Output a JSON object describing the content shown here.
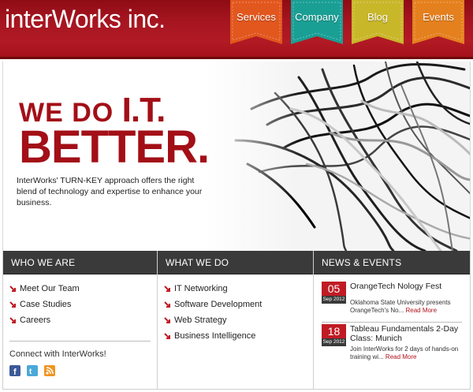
{
  "header": {
    "logo_text": "interWorks inc.",
    "nav": [
      {
        "label": "Services",
        "color": "#e2571e"
      },
      {
        "label": "Company",
        "color": "#1a9f95"
      },
      {
        "label": "Blog",
        "color": "#c9b72a"
      },
      {
        "label": "Events",
        "color": "#e5801e"
      }
    ]
  },
  "hero": {
    "line1_prefix": "WE DO ",
    "line1_emph": "I.T.",
    "line2": "BETTER.",
    "tagline": "InterWorks' TURN-KEY approach offers the right blend of technology and expertise to enhance your business."
  },
  "who_we_are": {
    "heading": "WHO WE ARE",
    "links": [
      "Meet Our Team",
      "Case Studies",
      "Careers"
    ],
    "connect_label": "Connect with InterWorks!",
    "social_icons": [
      "facebook-icon",
      "twitter-icon",
      "rss-icon"
    ]
  },
  "what_we_do": {
    "heading": "WHAT WE DO",
    "links": [
      "IT Networking",
      "Software Development",
      "Web Strategy",
      "Business Intelligence"
    ]
  },
  "news_events": {
    "heading": "NEWS & EVENTS",
    "items": [
      {
        "day": "05",
        "month": "Sep 2012",
        "title": "OrangeTech Nology Fest",
        "body": "Oklahoma State University presents OrangeTech's No...",
        "more": "Read More"
      },
      {
        "day": "18",
        "month": "Sep 2012",
        "title": "Tableau Fundamentals 2-Day Class: Munich",
        "body": "Join InterWorks for 2 days of hands-on training wi...",
        "more": "Read More"
      }
    ]
  },
  "colors": {
    "brand_red": "#a30f17",
    "header_red": "#b21a24",
    "arrow_red": "#c01b24",
    "dark_bar": "#3a3a3a"
  }
}
